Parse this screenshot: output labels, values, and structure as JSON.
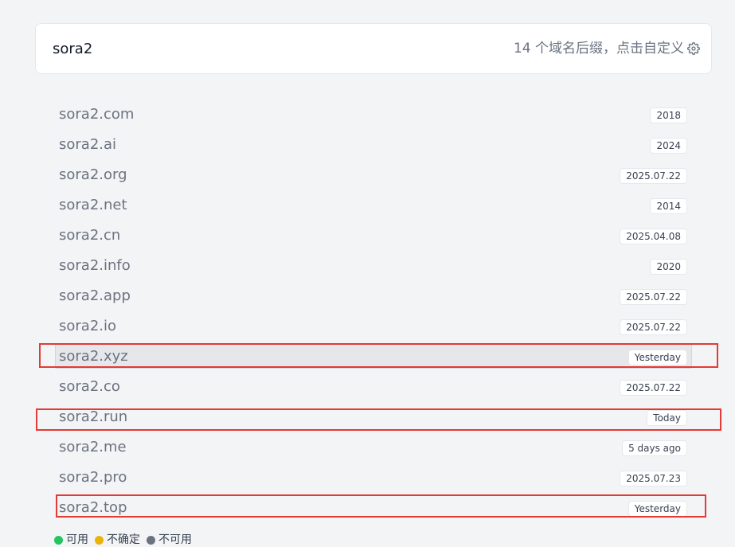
{
  "search": {
    "query": "sora2",
    "suffix_info": "14 个域名后缀，点击自定义",
    "settings_icon": "gear-icon"
  },
  "domains": [
    {
      "name": "sora2.com",
      "date": "2018"
    },
    {
      "name": "sora2.ai",
      "date": "2024"
    },
    {
      "name": "sora2.org",
      "date": "2025.07.22"
    },
    {
      "name": "sora2.net",
      "date": "2014"
    },
    {
      "name": "sora2.cn",
      "date": "2025.04.08"
    },
    {
      "name": "sora2.info",
      "date": "2020"
    },
    {
      "name": "sora2.app",
      "date": "2025.07.22"
    },
    {
      "name": "sora2.io",
      "date": "2025.07.22"
    },
    {
      "name": "sora2.xyz",
      "date": "Yesterday"
    },
    {
      "name": "sora2.co",
      "date": "2025.07.22"
    },
    {
      "name": "sora2.run",
      "date": "Today"
    },
    {
      "name": "sora2.me",
      "date": "5 days ago"
    },
    {
      "name": "sora2.pro",
      "date": "2025.07.23"
    },
    {
      "name": "sora2.top",
      "date": "Yesterday"
    }
  ],
  "legend": [
    {
      "label": "可用",
      "color": "#22c55e"
    },
    {
      "label": "不确定",
      "color": "#eab308"
    },
    {
      "label": "不可用",
      "color": "#6b7280"
    }
  ],
  "colors": {
    "annotation_box": "#e53935",
    "hover_row": "#e5e7eb"
  }
}
